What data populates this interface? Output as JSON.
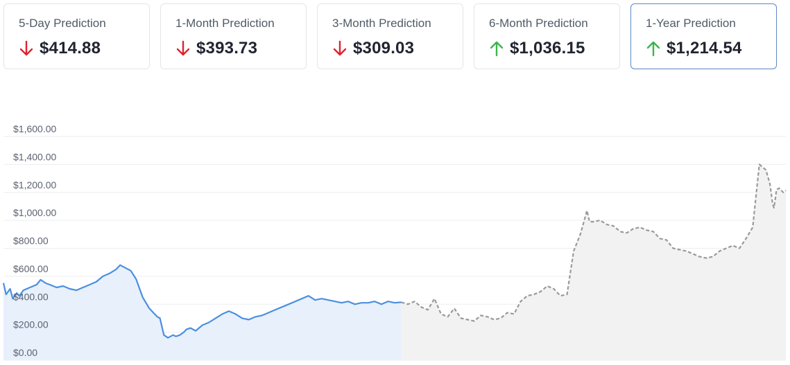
{
  "cards": [
    {
      "title": "5-Day Prediction",
      "value": "$414.88",
      "direction": "down",
      "active": false
    },
    {
      "title": "1-Month Prediction",
      "value": "$393.73",
      "direction": "down",
      "active": false
    },
    {
      "title": "3-Month Prediction",
      "value": "$309.03",
      "direction": "down",
      "active": false
    },
    {
      "title": "6-Month Prediction",
      "value": "$1,036.15",
      "direction": "up",
      "active": false
    },
    {
      "title": "1-Year Prediction",
      "value": "$1,214.54",
      "direction": "up",
      "active": true
    }
  ],
  "colors": {
    "up": "#3cb44b",
    "down": "#e0202f",
    "historical_line": "#4a8fe0",
    "historical_fill": "#e8f0fc",
    "forecast_line": "#9a9a9a",
    "forecast_fill": "#f2f2f2",
    "grid": "#eceef1"
  },
  "chart_data": {
    "type": "area",
    "ylim": [
      0,
      1600
    ],
    "yticks": [
      "$0.00",
      "$200.00",
      "$400.00",
      "$600.00",
      "$800.00",
      "$1,000.00",
      "$1,200.00",
      "$1,400.00",
      "$1,600.00"
    ],
    "grid": true,
    "series": [
      {
        "style": "solid",
        "x": [
          0,
          2,
          5,
          7,
          10,
          12,
          15,
          20,
          25,
          28,
          32,
          35,
          40,
          45,
          50,
          55,
          60,
          65,
          70,
          75,
          80,
          85,
          88,
          92,
          96,
          100,
          105,
          110,
          113,
          116,
          118,
          121,
          124,
          128,
          130,
          133,
          136,
          138,
          141,
          145,
          150,
          155,
          160,
          165,
          170,
          175,
          180,
          185,
          190,
          195,
          200,
          205,
          210,
          215,
          220,
          225,
          230,
          235,
          240,
          245,
          250,
          255,
          260,
          265,
          270,
          275,
          280,
          285,
          290,
          295,
          300
        ],
        "y": [
          552,
          470,
          510,
          440,
          480,
          460,
          500,
          520,
          540,
          575,
          550,
          540,
          520,
          530,
          510,
          500,
          520,
          540,
          560,
          600,
          620,
          650,
          680,
          660,
          640,
          580,
          450,
          370,
          340,
          310,
          300,
          180,
          160,
          180,
          170,
          180,
          200,
          220,
          230,
          210,
          250,
          270,
          300,
          330,
          350,
          330,
          300,
          290,
          310,
          320,
          340,
          360,
          380,
          400,
          420,
          440,
          460,
          430,
          440,
          430,
          420,
          410,
          420,
          400,
          410,
          410,
          420,
          400,
          420,
          410,
          414
        ]
      },
      {
        "style": "dashed",
        "x": [
          300,
          305,
          310,
          315,
          320,
          325,
          330,
          335,
          340,
          345,
          350,
          355,
          360,
          365,
          370,
          375,
          380,
          385,
          390,
          395,
          400,
          405,
          410,
          415,
          420,
          425,
          430,
          435,
          438,
          440,
          442,
          445,
          450,
          455,
          460,
          465,
          470,
          475,
          480,
          485,
          490,
          495,
          500,
          505,
          510,
          515,
          520,
          525,
          530,
          535,
          540,
          545,
          550,
          555,
          560,
          565,
          570,
          575,
          578,
          580,
          581,
          582,
          583,
          585,
          588,
          590
        ],
        "y": [
          414,
          400,
          420,
          380,
          360,
          440,
          330,
          310,
          370,
          300,
          290,
          280,
          320,
          310,
          290,
          300,
          340,
          330,
          420,
          460,
          470,
          490,
          530,
          510,
          460,
          470,
          780,
          900,
          1000,
          1070,
          990,
          990,
          1000,
          970,
          960,
          920,
          910,
          940,
          950,
          930,
          920,
          870,
          860,
          800,
          790,
          780,
          760,
          740,
          730,
          740,
          780,
          800,
          820,
          800,
          870,
          950,
          1400,
          1360,
          1260,
          1120,
          1090,
          1150,
          1220,
          1230,
          1200,
          1215
        ]
      }
    ]
  }
}
